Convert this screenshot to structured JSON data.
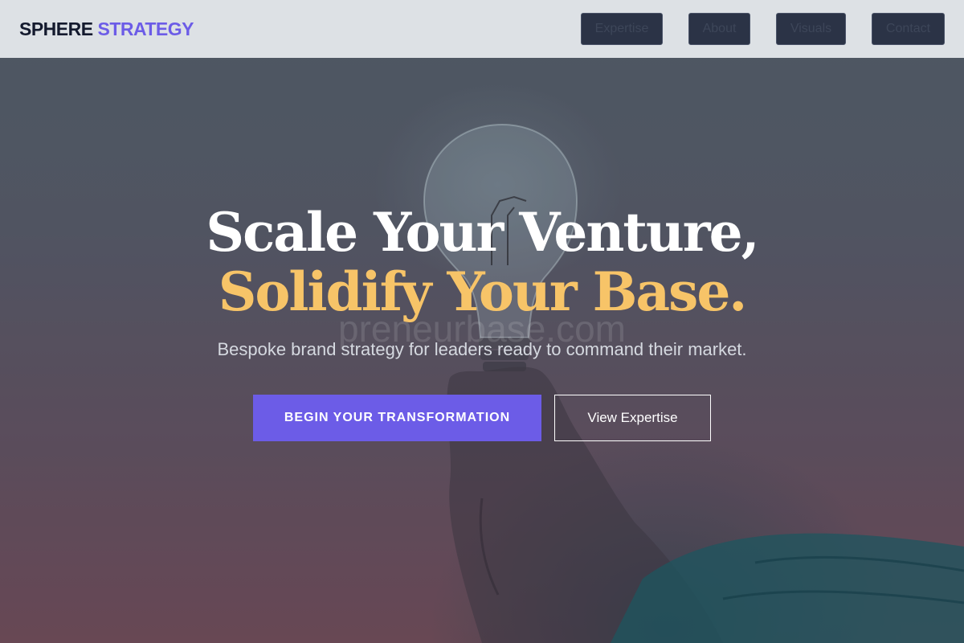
{
  "brand": {
    "part1": "SPHERE",
    "part2": "STRATEGY"
  },
  "nav": [
    {
      "label": "Expertise"
    },
    {
      "label": "About"
    },
    {
      "label": "Visuals"
    },
    {
      "label": "Contact"
    }
  ],
  "hero": {
    "headline_line1": "Scale Your Venture,",
    "headline_line2": "Solidify Your Base.",
    "watermark": "preneurbase.com",
    "subtitle": "Bespoke brand strategy for leaders ready to command their market.",
    "cta_primary": "BEGIN YOUR TRANSFORMATION",
    "cta_secondary": "View Expertise"
  },
  "colors": {
    "accent": "#6c5ce7",
    "headline_highlight": "#f7c468",
    "header_bg": "#dde1e5",
    "nav_button_bg": "#2b3346"
  },
  "icons": {
    "background_image": "lightbulb-in-hand-photo"
  }
}
